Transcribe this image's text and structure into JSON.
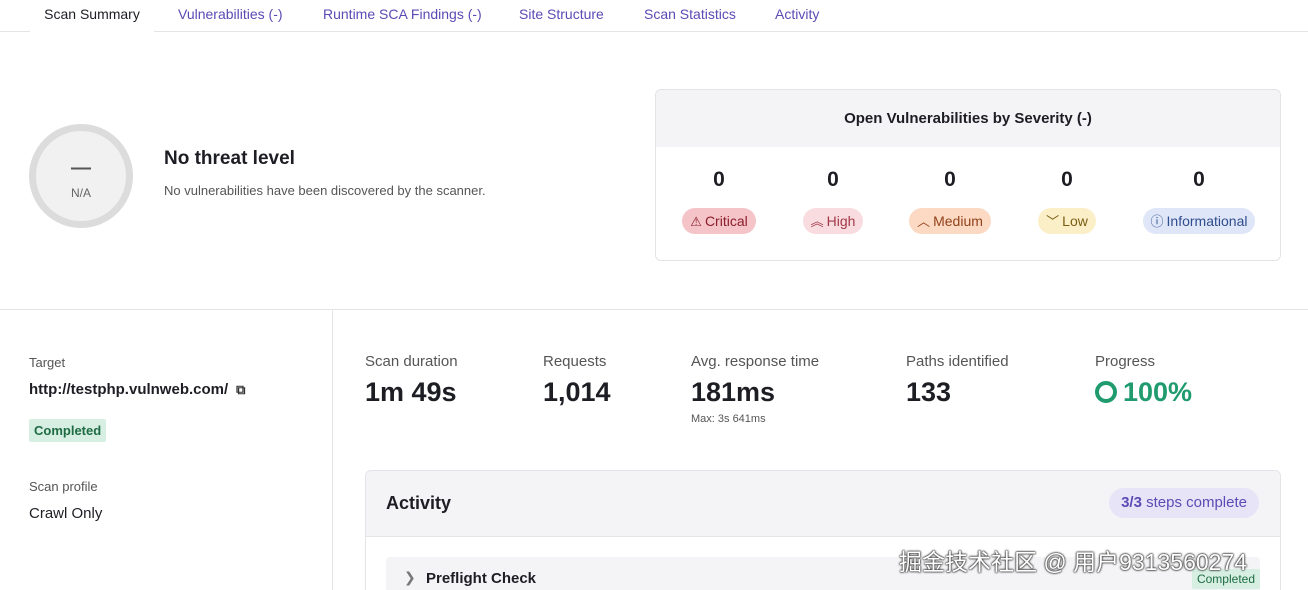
{
  "tabs": [
    {
      "label": "Scan Summary",
      "active": true
    },
    {
      "label": "Vulnerabilities (-)"
    },
    {
      "label": "Runtime SCA Findings (-)"
    },
    {
      "label": "Site Structure"
    },
    {
      "label": "Scan Statistics"
    },
    {
      "label": "Activity"
    }
  ],
  "threat": {
    "gauge_dash": "—",
    "gauge_label": "N/A",
    "title": "No threat level",
    "description": "No vulnerabilities have been discovered by the scanner."
  },
  "severity": {
    "title": "Open Vulnerabilities by Severity (-)",
    "items": [
      {
        "count": "0",
        "label": "Critical",
        "icon": "warning-triangle-icon"
      },
      {
        "count": "0",
        "label": "High",
        "icon": "double-chevron-up-icon"
      },
      {
        "count": "0",
        "label": "Medium",
        "icon": "chevron-up-icon"
      },
      {
        "count": "0",
        "label": "Low",
        "icon": "chevron-down-icon"
      },
      {
        "count": "0",
        "label": "Informational",
        "icon": "info-circle-icon"
      }
    ]
  },
  "details": {
    "target_label": "Target",
    "target_url": "http://testphp.vulnweb.com/",
    "status": "Completed",
    "profile_label": "Scan profile",
    "profile_value": "Crawl Only"
  },
  "stats": {
    "duration_label": "Scan duration",
    "duration_value": "1m 49s",
    "requests_label": "Requests",
    "requests_value": "1,014",
    "response_label": "Avg. response time",
    "response_value": "181ms",
    "response_max": "Max: 3s 641ms",
    "paths_label": "Paths identified",
    "paths_value": "133",
    "progress_label": "Progress",
    "progress_value": "100%",
    "progress_fraction": 1.0
  },
  "activity": {
    "title": "Activity",
    "steps_count": "3/3",
    "steps_text": "steps complete",
    "steps": [
      {
        "name": "Preflight Check",
        "status": "Completed"
      }
    ]
  },
  "watermark": "掘金技术社区 @ 用户9313560274",
  "colors": {
    "accent": "#5b4bb5",
    "success": "#1f9b6e"
  }
}
